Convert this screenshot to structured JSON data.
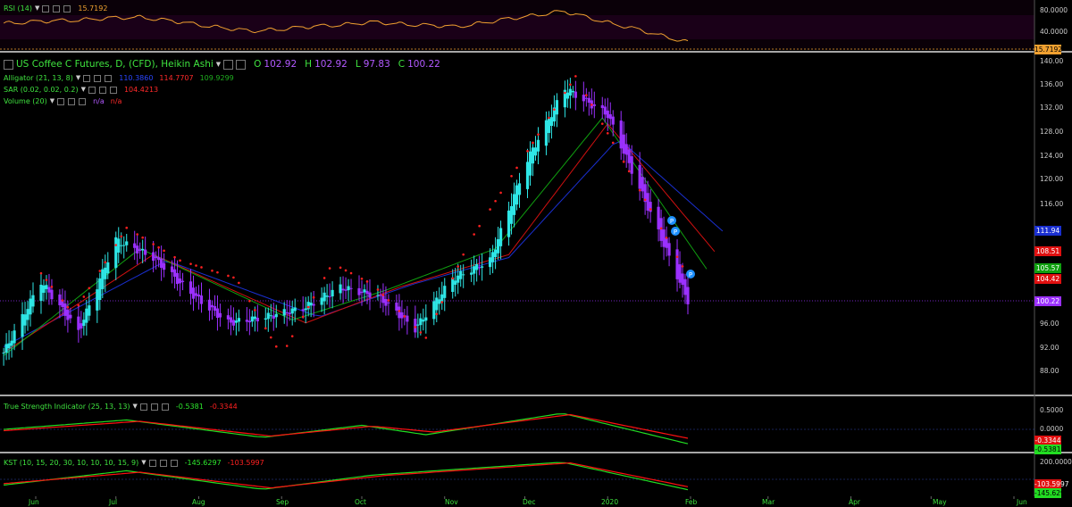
{
  "main": {
    "title": "US Coffee C Futures, D, (CFD), Heikin Ashi",
    "ohlc": {
      "o_label": "O",
      "o": "102.92",
      "h_label": "H",
      "h": "102.92",
      "l_label": "L",
      "l": "97.83",
      "c_label": "C",
      "c": "100.22"
    },
    "alligator": {
      "name": "Alligator (21, 13, 8)",
      "v1": "110.3860",
      "v2": "114.7707",
      "v3": "109.9299"
    },
    "sar": {
      "name": "SAR (0.02, 0.02, 0.2)",
      "v": "104.4213"
    },
    "volume": {
      "name": "Volume (20)",
      "v1": "n/a",
      "v2": "n/a"
    },
    "yticks": [
      "140.00",
      "136.00",
      "132.00",
      "128.00",
      "124.00",
      "120.00",
      "116.00",
      "96.00",
      "92.00",
      "88.00"
    ],
    "tags": {
      "jaw": "111.94",
      "teeth": "108.51",
      "lips": "105.57",
      "sar": "104.42",
      "last": "100.22"
    }
  },
  "rsi": {
    "name": "RSI (14)",
    "value": "15.7192",
    "yticks": [
      "80.0000",
      "40.0000"
    ],
    "tag": "15.7192"
  },
  "tsi": {
    "name": "True Strength Indicator (25, 13, 13)",
    "v1": "-0.5381",
    "v2": "-0.3344",
    "yticks": [
      "0.5000",
      "0.0000"
    ],
    "tag1": "-0.3344",
    "tag2": "-0.5381"
  },
  "kst": {
    "name": "KST (10, 15, 20, 30, 10, 10, 10, 15, 9)",
    "v1": "-145.6297",
    "v2": "-103.5997",
    "yticks": [
      "200.0000"
    ],
    "tag1": "-103.5997",
    "tag2": "-145.6297"
  },
  "xaxis": {
    "labels": [
      "Jun",
      "Jul",
      "Aug",
      "Sep",
      "Oct",
      "Nov",
      "Dec",
      "2020",
      "Feb",
      "Mar",
      "Apr",
      "May",
      "Jun"
    ]
  },
  "colors": {
    "up": "#2ee6e6",
    "down": "#9b30ff",
    "sar": "#ff2020",
    "jaw": "#1a2fd0",
    "teeth": "#d01010",
    "lips": "#10a010",
    "rsi": "#f0a030",
    "green": "#22dd22",
    "red": "#ff1010"
  },
  "chart_data": {
    "type": "candlestick",
    "title": "US Coffee C Futures, D, (CFD), Heikin Ashi",
    "xlabel": "",
    "ylabel": "",
    "ylim": [
      85,
      141
    ],
    "x_range": [
      "2019-05-20",
      "2020-06-15"
    ],
    "keypoints": [
      {
        "date": "2019-05-20",
        "close": 91.5
      },
      {
        "date": "2019-06-03",
        "close": 103.5
      },
      {
        "date": "2019-06-17",
        "close": 95.0
      },
      {
        "date": "2019-07-01",
        "close": 110.5
      },
      {
        "date": "2019-07-15",
        "close": 107.5
      },
      {
        "date": "2019-07-29",
        "close": 101.5
      },
      {
        "date": "2019-08-12",
        "close": 96.5
      },
      {
        "date": "2019-08-26",
        "close": 97.5
      },
      {
        "date": "2019-09-09",
        "close": 99.0
      },
      {
        "date": "2019-09-23",
        "close": 102.5
      },
      {
        "date": "2019-10-07",
        "close": 101.0
      },
      {
        "date": "2019-10-21",
        "close": 95.5
      },
      {
        "date": "2019-11-04",
        "close": 104.0
      },
      {
        "date": "2019-11-18",
        "close": 107.0
      },
      {
        "date": "2019-12-02",
        "close": 124.0
      },
      {
        "date": "2019-12-16",
        "close": 136.0
      },
      {
        "date": "2020-01-01",
        "close": 131.5
      },
      {
        "date": "2020-01-15",
        "close": 117.0
      },
      {
        "date": "2020-01-31",
        "close": 100.22
      }
    ],
    "sar_points": [
      {
        "date": "2019-06-01",
        "v": 106.0
      },
      {
        "date": "2019-06-15",
        "v": 98.0
      },
      {
        "date": "2019-07-05",
        "v": 112.5
      },
      {
        "date": "2019-07-25",
        "v": 107.0
      },
      {
        "date": "2019-08-15",
        "v": 104.0
      },
      {
        "date": "2019-09-01",
        "v": 91.0
      },
      {
        "date": "2019-09-20",
        "v": 106.5
      },
      {
        "date": "2019-10-05",
        "v": 103.0
      },
      {
        "date": "2019-10-25",
        "v": 94.0
      },
      {
        "date": "2019-11-10",
        "v": 110.0
      },
      {
        "date": "2019-12-20",
        "v": 138.0
      },
      {
        "date": "2020-01-31",
        "v": 104.42
      }
    ],
    "alligator": {
      "jaw": [
        {
          "date": "2019-05-20",
          "v": 92.5
        },
        {
          "date": "2019-07-20",
          "v": 107.0
        },
        {
          "date": "2019-09-15",
          "v": 97.5
        },
        {
          "date": "2019-10-20",
          "v": 103.0
        },
        {
          "date": "2019-11-25",
          "v": 107.5
        },
        {
          "date": "2020-01-05",
          "v": 127.5
        },
        {
          "date": "2020-02-13",
          "v": 111.94
        }
      ],
      "teeth": [
        {
          "date": "2019-05-20",
          "v": 91.5
        },
        {
          "date": "2019-07-15",
          "v": 108.0
        },
        {
          "date": "2019-09-10",
          "v": 96.5
        },
        {
          "date": "2019-10-15",
          "v": 102.5
        },
        {
          "date": "2019-11-25",
          "v": 108.0
        },
        {
          "date": "2020-01-01",
          "v": 130.0
        },
        {
          "date": "2020-02-10",
          "v": 108.51
        }
      ],
      "lips": [
        {
          "date": "2019-05-20",
          "v": 91.0
        },
        {
          "date": "2019-07-10",
          "v": 109.0
        },
        {
          "date": "2019-09-05",
          "v": 97.0
        },
        {
          "date": "2019-10-10",
          "v": 102.0
        },
        {
          "date": "2019-11-20",
          "v": 109.0
        },
        {
          "date": "2019-12-30",
          "v": 131.0
        },
        {
          "date": "2020-02-07",
          "v": 105.57
        }
      ]
    },
    "rsi": [
      {
        "date": "2019-05-20",
        "v": 58
      },
      {
        "date": "2019-07-10",
        "v": 72
      },
      {
        "date": "2019-08-20",
        "v": 40
      },
      {
        "date": "2019-10-05",
        "v": 60
      },
      {
        "date": "2019-11-05",
        "v": 50
      },
      {
        "date": "2019-12-15",
        "v": 85
      },
      {
        "date": "2020-01-31",
        "v": 15.72
      }
    ],
    "tsi": {
      "tsi": [
        {
          "date": "2019-05-20",
          "v": 0.0
        },
        {
          "date": "2019-07-05",
          "v": 0.35
        },
        {
          "date": "2019-08-25",
          "v": -0.3
        },
        {
          "date": "2019-10-01",
          "v": 0.15
        },
        {
          "date": "2019-10-25",
          "v": -0.2
        },
        {
          "date": "2019-12-15",
          "v": 0.6
        },
        {
          "date": "2020-01-31",
          "v": -0.5381
        }
      ],
      "signal": [
        {
          "date": "2019-05-20",
          "v": -0.05
        },
        {
          "date": "2019-07-10",
          "v": 0.3
        },
        {
          "date": "2019-08-28",
          "v": -0.25
        },
        {
          "date": "2019-10-05",
          "v": 0.12
        },
        {
          "date": "2019-10-28",
          "v": -0.1
        },
        {
          "date": "2019-12-18",
          "v": 0.55
        },
        {
          "date": "2020-01-31",
          "v": -0.3344
        }
      ]
    },
    "kst": {
      "kst": [
        {
          "date": "2019-05-20",
          "v": -80
        },
        {
          "date": "2019-07-05",
          "v": 120
        },
        {
          "date": "2019-08-25",
          "v": -140
        },
        {
          "date": "2019-10-05",
          "v": 60
        },
        {
          "date": "2019-12-15",
          "v": 240
        },
        {
          "date": "2020-01-31",
          "v": -145.63
        }
      ],
      "signal": [
        {
          "date": "2019-05-20",
          "v": -60
        },
        {
          "date": "2019-07-10",
          "v": 100
        },
        {
          "date": "2019-08-28",
          "v": -120
        },
        {
          "date": "2019-10-10",
          "v": 55
        },
        {
          "date": "2019-12-18",
          "v": 230
        },
        {
          "date": "2020-01-31",
          "v": -103.6
        }
      ]
    }
  }
}
